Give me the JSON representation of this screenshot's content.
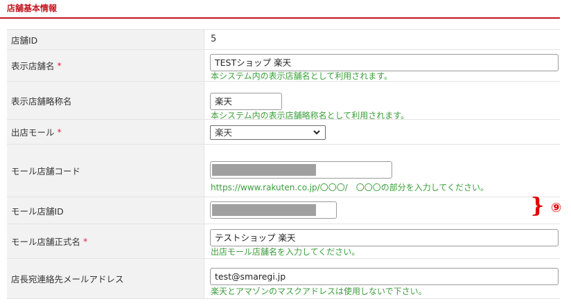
{
  "section": {
    "title": "店舗基本情報"
  },
  "fields": {
    "store_id": {
      "label": "店舗ID",
      "value": "5"
    },
    "display_name": {
      "label": "表示店舗名",
      "required_mark": "*",
      "value": "TESTショップ 楽天",
      "hint": "本システム内の表示店舗名として利用されます。"
    },
    "display_short_name": {
      "label": "表示店舗略称名",
      "value": "楽天",
      "hint": "本システム内の表示店舗略称名として利用されます。"
    },
    "mall": {
      "label": "出店モール",
      "required_mark": "*",
      "selected": "楽天"
    },
    "mall_store_code": {
      "label": "モール店舗コード",
      "value": "",
      "masked": true,
      "hint": "https://www.rakuten.co.jp/〇〇〇/　〇〇〇の部分を入力してください。"
    },
    "mall_store_id": {
      "label": "モール店舗ID",
      "value": "",
      "masked": true
    },
    "mall_official_name": {
      "label": "モール店舗正式名",
      "required_mark": "*",
      "value": "テストショップ 楽天",
      "hint": "出店モール店舗名を入力してください。"
    },
    "manager_email": {
      "label": "店長宛連絡先メールアドレス",
      "value": "test@smaregi.jp",
      "hint": "楽天とアマゾンのマスクアドレスは使用しないで下さい。"
    }
  },
  "annotation": {
    "brace": "}",
    "marker": "⑨"
  },
  "colors": {
    "section_title": "#c4131f",
    "required": "#d7263d",
    "hint": "#3a9d3a",
    "annotation": "#e10000"
  },
  "icons": {
    "select_arrow": "chevron-down-icon"
  }
}
